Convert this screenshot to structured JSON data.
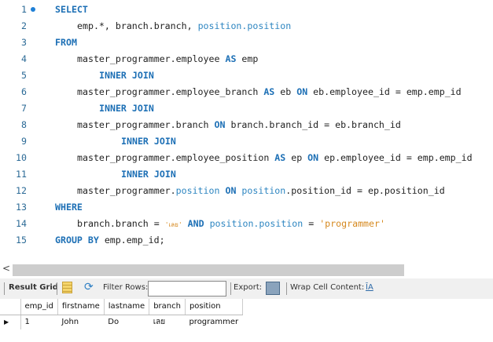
{
  "editor": {
    "lines": [
      {
        "n": "1",
        "dot": true,
        "indent": 0,
        "tokens": [
          {
            "t": "SELECT",
            "c": "kw"
          }
        ]
      },
      {
        "n": "2",
        "indent": 4,
        "tokens": [
          {
            "t": "emp.*, branch.branch, ",
            "c": ""
          },
          {
            "t": "position.position",
            "c": "id"
          }
        ]
      },
      {
        "n": "3",
        "indent": 0,
        "tokens": [
          {
            "t": "FROM",
            "c": "kw"
          }
        ]
      },
      {
        "n": "4",
        "indent": 4,
        "tokens": [
          {
            "t": "master_programmer.employee ",
            "c": ""
          },
          {
            "t": "AS",
            "c": "kw"
          },
          {
            "t": " emp",
            "c": ""
          }
        ]
      },
      {
        "n": "5",
        "indent": 8,
        "tokens": [
          {
            "t": "INNER JOIN",
            "c": "kw"
          }
        ]
      },
      {
        "n": "6",
        "indent": 4,
        "tokens": [
          {
            "t": "master_programmer.employee_branch ",
            "c": ""
          },
          {
            "t": "AS",
            "c": "kw"
          },
          {
            "t": " eb ",
            "c": ""
          },
          {
            "t": "ON",
            "c": "kw"
          },
          {
            "t": " eb.employee_id = emp.emp_id",
            "c": ""
          }
        ]
      },
      {
        "n": "7",
        "indent": 8,
        "tokens": [
          {
            "t": "INNER JOIN",
            "c": "kw"
          }
        ]
      },
      {
        "n": "8",
        "indent": 4,
        "tokens": [
          {
            "t": "master_programmer.branch ",
            "c": ""
          },
          {
            "t": "ON",
            "c": "kw"
          },
          {
            "t": " branch.branch_id = eb.branch_id",
            "c": ""
          }
        ]
      },
      {
        "n": "9",
        "indent": 12,
        "tokens": [
          {
            "t": "INNER JOIN",
            "c": "kw"
          }
        ]
      },
      {
        "n": "10",
        "indent": 4,
        "tokens": [
          {
            "t": "master_programmer.employee_position ",
            "c": ""
          },
          {
            "t": "AS",
            "c": "kw"
          },
          {
            "t": " ep ",
            "c": ""
          },
          {
            "t": "ON",
            "c": "kw"
          },
          {
            "t": " ep.employee_id = emp.emp_id",
            "c": ""
          }
        ]
      },
      {
        "n": "11",
        "indent": 12,
        "tokens": [
          {
            "t": "INNER JOIN",
            "c": "kw"
          }
        ]
      },
      {
        "n": "12",
        "indent": 4,
        "tokens": [
          {
            "t": "master_programmer.",
            "c": ""
          },
          {
            "t": "position",
            "c": "id"
          },
          {
            "t": " ",
            "c": ""
          },
          {
            "t": "ON",
            "c": "kw"
          },
          {
            "t": " ",
            "c": ""
          },
          {
            "t": "position",
            "c": "id"
          },
          {
            "t": ".position_id = ep.position_id",
            "c": ""
          }
        ]
      },
      {
        "n": "13",
        "indent": 0,
        "tokens": [
          {
            "t": "WHERE",
            "c": "kw"
          }
        ]
      },
      {
        "n": "14",
        "indent": 4,
        "tokens": [
          {
            "t": "branch.branch = ",
            "c": ""
          },
          {
            "t": "'เลย'",
            "c": "th"
          },
          {
            "t": " ",
            "c": ""
          },
          {
            "t": "AND",
            "c": "kw"
          },
          {
            "t": " ",
            "c": ""
          },
          {
            "t": "position.position",
            "c": "id"
          },
          {
            "t": " = ",
            "c": ""
          },
          {
            "t": "'programmer'",
            "c": "str"
          }
        ]
      },
      {
        "n": "15",
        "indent": 0,
        "tokens": [
          {
            "t": "GROUP BY",
            "c": "kw"
          },
          {
            "t": " emp.emp_id;",
            "c": ""
          }
        ]
      }
    ]
  },
  "scroll": {
    "left_icon": "chevron-left-icon",
    "arrow": "<"
  },
  "toolbar": {
    "result_grid": "Result Grid",
    "filter_label": "Filter Rows:",
    "filter_value": "",
    "export": "Export:",
    "wrap": "Wrap Cell Content:",
    "wrap_icon": "ĪA"
  },
  "grid": {
    "columns": [
      "emp_id",
      "firstname",
      "lastname",
      "branch",
      "position"
    ],
    "rows": [
      [
        "1",
        "John",
        "Do",
        "เลย",
        "programmer"
      ]
    ],
    "row_pointer": "▶"
  }
}
